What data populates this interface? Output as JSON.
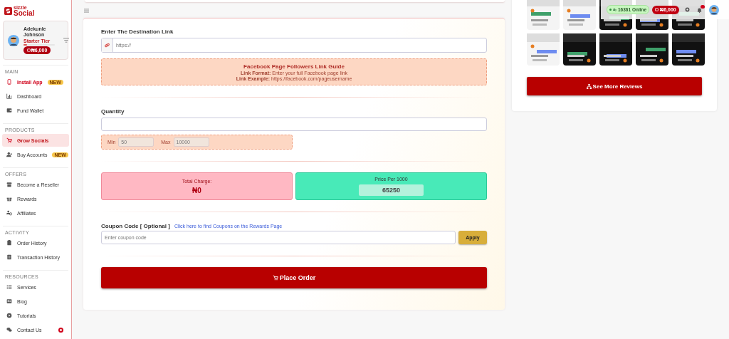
{
  "logo": {
    "line1": "sizzle",
    "line2": "Social"
  },
  "profile": {
    "name": "Adekunle Johnson",
    "tier": "Starter Tier",
    "level": 0.12,
    "balance": "₦6,000"
  },
  "sidebar": {
    "sections": [
      {
        "title": "MAIN",
        "items": [
          {
            "label": "Install App",
            "badge": "NEW",
            "highlighted": true,
            "selected": false,
            "alert": false
          },
          {
            "label": "Dashboard",
            "highlighted": false,
            "selected": false,
            "alert": false
          },
          {
            "label": "Fund Wallet",
            "highlighted": false,
            "selected": false,
            "alert": false
          }
        ]
      },
      {
        "title": "PRODUCTS",
        "items": [
          {
            "label": "Grow Socials",
            "highlighted": false,
            "selected": true,
            "alert": false
          },
          {
            "label": "Buy Accounts",
            "badge": "NEW",
            "highlighted": false,
            "selected": false,
            "alert": false
          }
        ]
      },
      {
        "title": "OFFERS",
        "items": [
          {
            "label": "Become a Reseller",
            "highlighted": false,
            "selected": false,
            "alert": false
          },
          {
            "label": "Rewards",
            "highlighted": false,
            "selected": false,
            "alert": false
          },
          {
            "label": "Affiliates",
            "highlighted": false,
            "selected": false,
            "alert": false
          }
        ]
      },
      {
        "title": "ACTIVITY",
        "items": [
          {
            "label": "Order History",
            "highlighted": false,
            "selected": false,
            "alert": false
          },
          {
            "label": "Transaction History",
            "highlighted": false,
            "selected": false,
            "alert": false
          }
        ]
      },
      {
        "title": "RESOURCES",
        "items": [
          {
            "label": "Services",
            "highlighted": false,
            "selected": false,
            "alert": false
          },
          {
            "label": "Blog",
            "highlighted": false,
            "selected": false,
            "alert": false
          },
          {
            "label": "Tutorials",
            "highlighted": false,
            "selected": false,
            "alert": false
          },
          {
            "label": "Contact Us",
            "highlighted": false,
            "selected": false,
            "alert": true
          }
        ]
      }
    ]
  },
  "topbar": {
    "online": "16361 Online",
    "balance": "₦6,000"
  },
  "form": {
    "link": {
      "label": "Enter The Destination Link",
      "placeholder": "https://"
    },
    "guide": {
      "title": "Facebook Page Followers Link Guide",
      "lines": [
        "**Link Format:** Enter your full Facebook page link",
        "**Link Example:** https://facebook.com/pageusername"
      ]
    },
    "quantity": {
      "label": "Quantity",
      "min_label": "Min",
      "min": "50",
      "max_label": "Max",
      "max": "10000"
    },
    "total": {
      "label": "Total Charge:",
      "value": "₦0"
    },
    "price": {
      "label": "Price Per 1000",
      "value": "65250"
    },
    "coupon": {
      "label": "Coupon Code [ Optional ]",
      "link": "Click here to find Coupons on the Rewards Page",
      "placeholder": "Enter coupon code",
      "button": "Apply"
    },
    "submit": "Place Order"
  },
  "reviews": {
    "button": "See More Reviews"
  }
}
